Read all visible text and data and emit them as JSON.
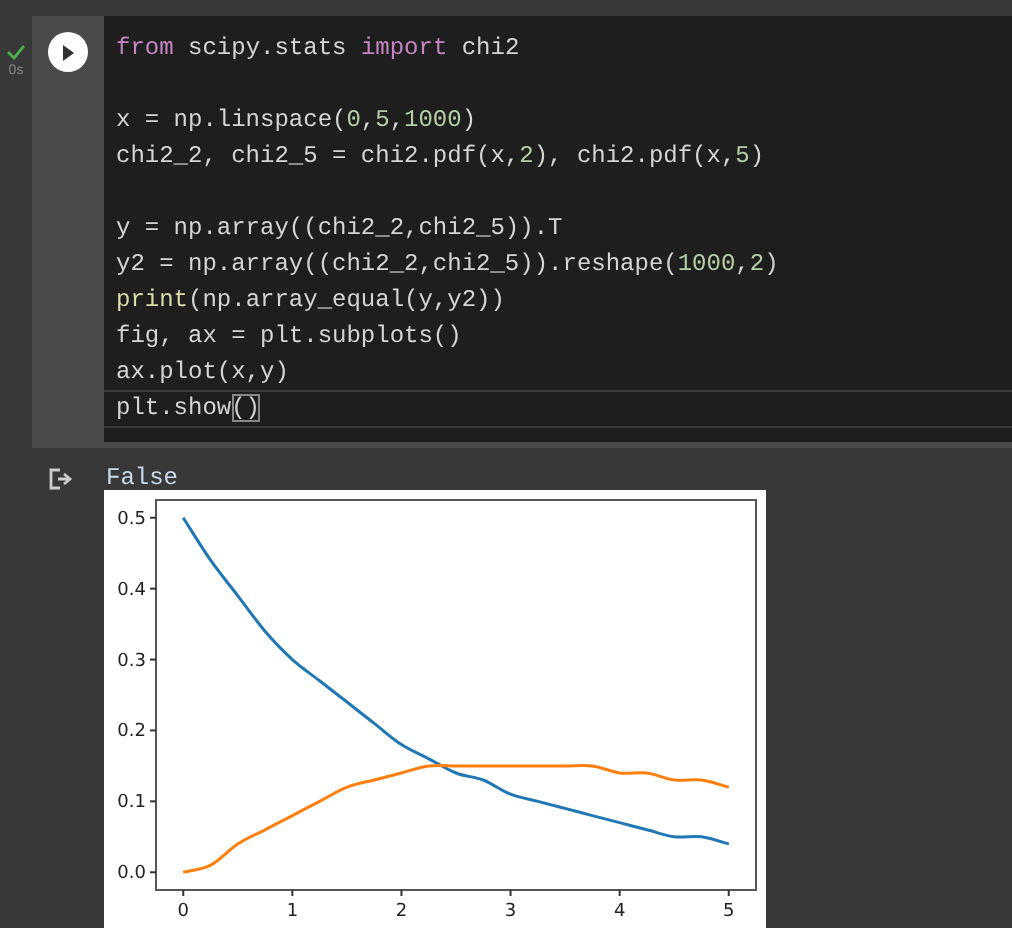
{
  "cell": {
    "succeeded": true,
    "exec_time": "0s",
    "code": [
      {
        "kind": "code",
        "tokens": [
          {
            "kind": "keyword",
            "text": "from"
          },
          {
            "kind": "plain",
            "text": " scipy.stats "
          },
          {
            "kind": "keyword",
            "text": "import"
          },
          {
            "kind": "plain",
            "text": " chi2"
          }
        ]
      },
      {
        "kind": "blank"
      },
      {
        "kind": "code",
        "tokens": [
          {
            "kind": "plain",
            "text": "x = np.linspace("
          },
          {
            "kind": "number",
            "text": "0"
          },
          {
            "kind": "plain",
            "text": ","
          },
          {
            "kind": "number",
            "text": "5"
          },
          {
            "kind": "plain",
            "text": ","
          },
          {
            "kind": "number",
            "text": "1000"
          },
          {
            "kind": "plain",
            "text": ")"
          }
        ]
      },
      {
        "kind": "code",
        "tokens": [
          {
            "kind": "plain",
            "text": "chi2_2, chi2_5 = chi2.pdf(x,"
          },
          {
            "kind": "number",
            "text": "2"
          },
          {
            "kind": "plain",
            "text": "), chi2.pdf(x,"
          },
          {
            "kind": "number",
            "text": "5"
          },
          {
            "kind": "plain",
            "text": ")"
          }
        ]
      },
      {
        "kind": "blank"
      },
      {
        "kind": "code",
        "tokens": [
          {
            "kind": "plain",
            "text": "y = np.array((chi2_2,chi2_5)).T"
          }
        ]
      },
      {
        "kind": "code",
        "tokens": [
          {
            "kind": "plain",
            "text": "y2 = np.array((chi2_2,chi2_5)).reshape("
          },
          {
            "kind": "number",
            "text": "1000"
          },
          {
            "kind": "plain",
            "text": ","
          },
          {
            "kind": "number",
            "text": "2"
          },
          {
            "kind": "plain",
            "text": ")"
          }
        ]
      },
      {
        "kind": "code",
        "tokens": [
          {
            "kind": "builtin",
            "text": "print"
          },
          {
            "kind": "plain",
            "text": "(np.array_equal(y,y2))"
          }
        ]
      },
      {
        "kind": "code",
        "tokens": [
          {
            "kind": "plain",
            "text": "fig, ax = plt.subplots()"
          }
        ]
      },
      {
        "kind": "code",
        "tokens": [
          {
            "kind": "plain",
            "text": "ax.plot(x,y)"
          }
        ]
      },
      {
        "kind": "code",
        "current": true,
        "tokens": [
          {
            "kind": "plain",
            "text": "plt.show"
          },
          {
            "kind": "bracket-match",
            "text": "()"
          }
        ]
      }
    ],
    "output": {
      "text": "False",
      "chart_data": {
        "type": "line",
        "x": [
          0,
          0.25,
          0.5,
          0.75,
          1,
          1.25,
          1.5,
          1.75,
          2,
          2.25,
          2.5,
          2.75,
          3,
          3.25,
          3.5,
          3.75,
          4,
          4.25,
          4.5,
          4.75,
          5
        ],
        "series": [
          {
            "color": "#1f77b4",
            "values": [
              0.5,
              0.44,
              0.39,
              0.34,
              0.3,
              0.27,
              0.24,
              0.21,
              0.18,
              0.16,
              0.14,
              0.13,
              0.11,
              0.1,
              0.09,
              0.08,
              0.07,
              0.06,
              0.05,
              0.05,
              0.04
            ]
          },
          {
            "color": "#ff7f0e",
            "values": [
              0,
              0.01,
              0.04,
              0.06,
              0.08,
              0.1,
              0.12,
              0.13,
              0.14,
              0.15,
              0.15,
              0.15,
              0.15,
              0.15,
              0.15,
              0.15,
              0.14,
              0.14,
              0.13,
              0.13,
              0.12
            ]
          }
        ],
        "xlim": [
          -0.25,
          5.25
        ],
        "ylim": [
          -0.025,
          0.525
        ],
        "xticks": [
          0,
          1,
          2,
          3,
          4,
          5
        ],
        "yticks": [
          {
            "value": 0,
            "label": "0.0"
          },
          {
            "value": 0.1,
            "label": "0.1"
          },
          {
            "value": 0.2,
            "label": "0.2"
          },
          {
            "value": 0.3,
            "label": "0.3"
          },
          {
            "value": 0.4,
            "label": "0.4"
          },
          {
            "value": 0.5,
            "label": "0.5"
          }
        ]
      }
    }
  }
}
